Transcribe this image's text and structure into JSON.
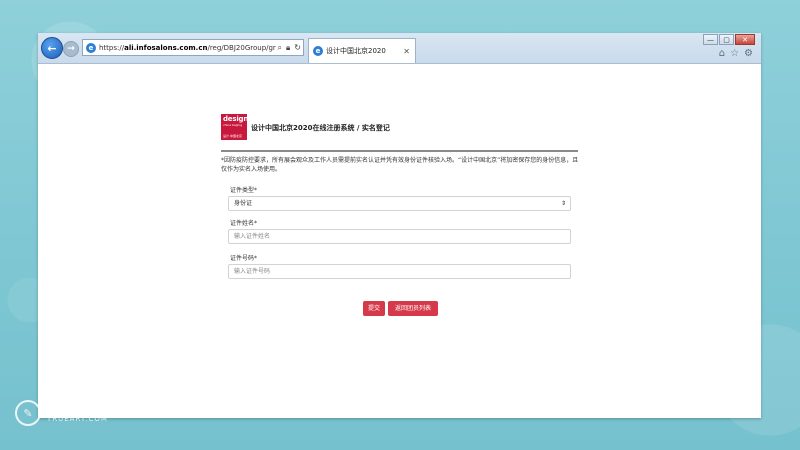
{
  "browser": {
    "url_prefix": "https://",
    "url_domain": "ali.infosalons.com.cn",
    "url_path": "/reg/DBJ20Group/grou",
    "search_icon": "magnifier-icon",
    "tab": {
      "icon": "ie-icon",
      "title": "设计中国北京2020"
    },
    "window_controls": {
      "minimize": "—",
      "maximize": "▢",
      "close": "✕"
    },
    "tools": {
      "home": "⌂",
      "favorites": "☆",
      "settings": "⚙"
    }
  },
  "page": {
    "logo": {
      "main": "design",
      "sub": "china beijing",
      "foot": "设计·中国北京"
    },
    "heading": "设计中国北京2020在线注册系统 / 实名登记",
    "notice": "*因防疫防控要求，所有展会观众及工作人员需提前实名认证并凭有效身份证件核验入场。“设计中国北京”将加密保存您的身份信息，且仅作为实名入场使用。",
    "form": {
      "id_type": {
        "label": "证件类型*",
        "value": "身份证",
        "caret": "⇕"
      },
      "id_name": {
        "label": "证件姓名*",
        "placeholder": "输入证件姓名"
      },
      "id_number": {
        "label": "证件号码*",
        "placeholder": "输入证件号码"
      }
    },
    "buttons": {
      "submit": "提交",
      "back": "返回团员列表"
    }
  },
  "watermark": {
    "cn": "凤凰艺客",
    "en": "TRUEART.COM"
  },
  "colors": {
    "accent": "#d63a4a",
    "logo": "#c9183d",
    "background": "#7ec7d3"
  }
}
